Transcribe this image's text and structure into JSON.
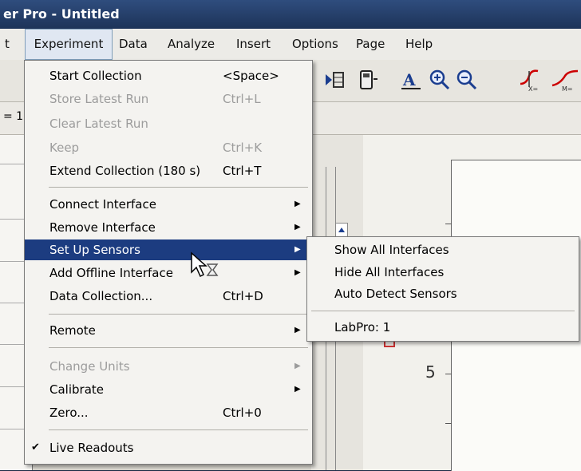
{
  "window": {
    "title": "er Pro - Untitled"
  },
  "menubar": {
    "items": [
      {
        "label": "t"
      },
      {
        "label": "Experiment"
      },
      {
        "label": "Data"
      },
      {
        "label": "Analyze"
      },
      {
        "label": "Insert"
      },
      {
        "label": "Options"
      },
      {
        "label": "Page"
      },
      {
        "label": "Help"
      }
    ]
  },
  "toolbar": {
    "row_label": "= 1"
  },
  "menu": {
    "items": [
      {
        "label": "Start Collection",
        "shortcut": "<Space>"
      },
      {
        "label": "Store Latest Run",
        "shortcut": "Ctrl+L"
      },
      {
        "label": "Clear Latest Run",
        "shortcut": ""
      },
      {
        "label": "Keep",
        "shortcut": "Ctrl+K"
      },
      {
        "label": "Extend Collection (180 s)",
        "shortcut": "Ctrl+T"
      },
      {
        "label": "Connect Interface"
      },
      {
        "label": "Remove Interface"
      },
      {
        "label": "Set Up Sensors"
      },
      {
        "label": "Add Offline Interface"
      },
      {
        "label": "Data Collection...",
        "shortcut": "Ctrl+D"
      },
      {
        "label": "Remote"
      },
      {
        "label": "Change Units"
      },
      {
        "label": "Calibrate"
      },
      {
        "label": "Zero...",
        "shortcut": "Ctrl+0"
      },
      {
        "label": "Live Readouts"
      }
    ]
  },
  "submenu": {
    "items": [
      {
        "label": "Show All Interfaces"
      },
      {
        "label": "Hide All Interfaces"
      },
      {
        "label": "Auto Detect Sensors"
      },
      {
        "label": "LabPro: 1"
      }
    ]
  },
  "graph": {
    "y_tick_label": "5"
  },
  "icons": {
    "toolbar_labels": [
      "X=",
      "M="
    ]
  }
}
